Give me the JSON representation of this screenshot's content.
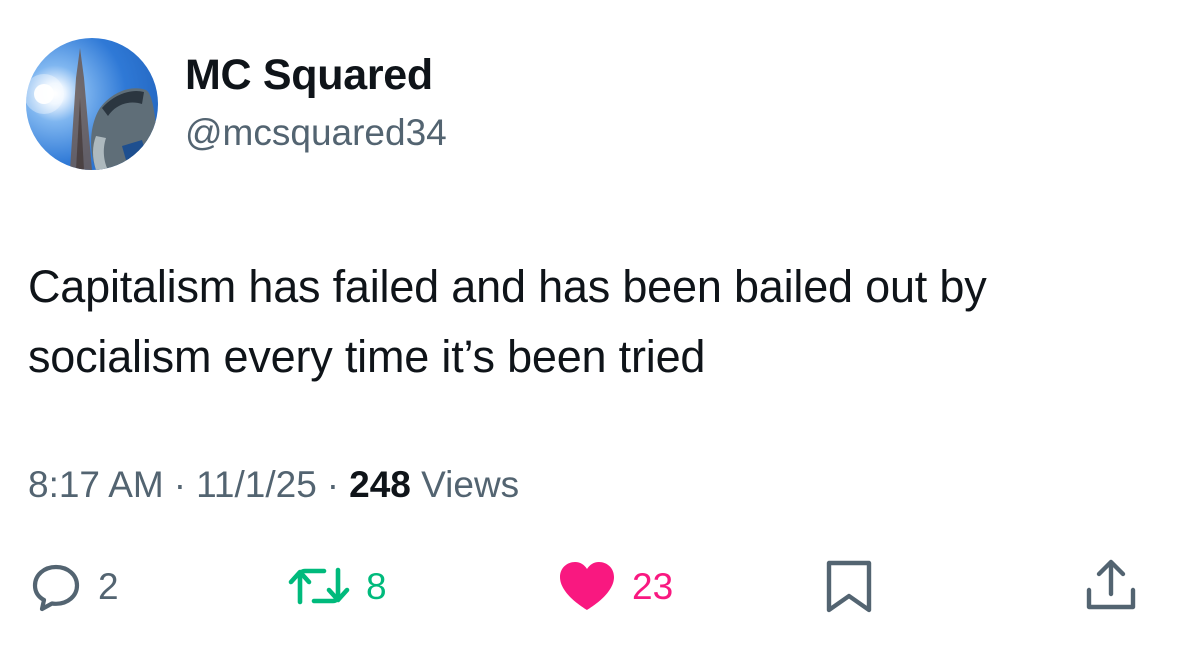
{
  "author": {
    "display_name": "MC Squared",
    "handle": "@mcsquared34"
  },
  "tweet": {
    "text": "Capitalism has failed and has been bailed out by socialism every time it’s been tried"
  },
  "meta": {
    "time": "8:17 AM",
    "separator": "·",
    "date": "11/1/25",
    "views_count": "248",
    "views_label": "Views"
  },
  "actions": {
    "replies": "2",
    "retweets": "8",
    "likes": "23"
  },
  "colors": {
    "text_primary": "#0f1419",
    "text_secondary": "#536471",
    "retweet": "#00ba7c",
    "like": "#f91880"
  },
  "icons": {
    "reply": "reply-bubble-icon",
    "retweet": "retweet-arrows-icon",
    "like": "heart-filled-icon",
    "bookmark": "bookmark-icon",
    "share": "share-upload-icon"
  }
}
